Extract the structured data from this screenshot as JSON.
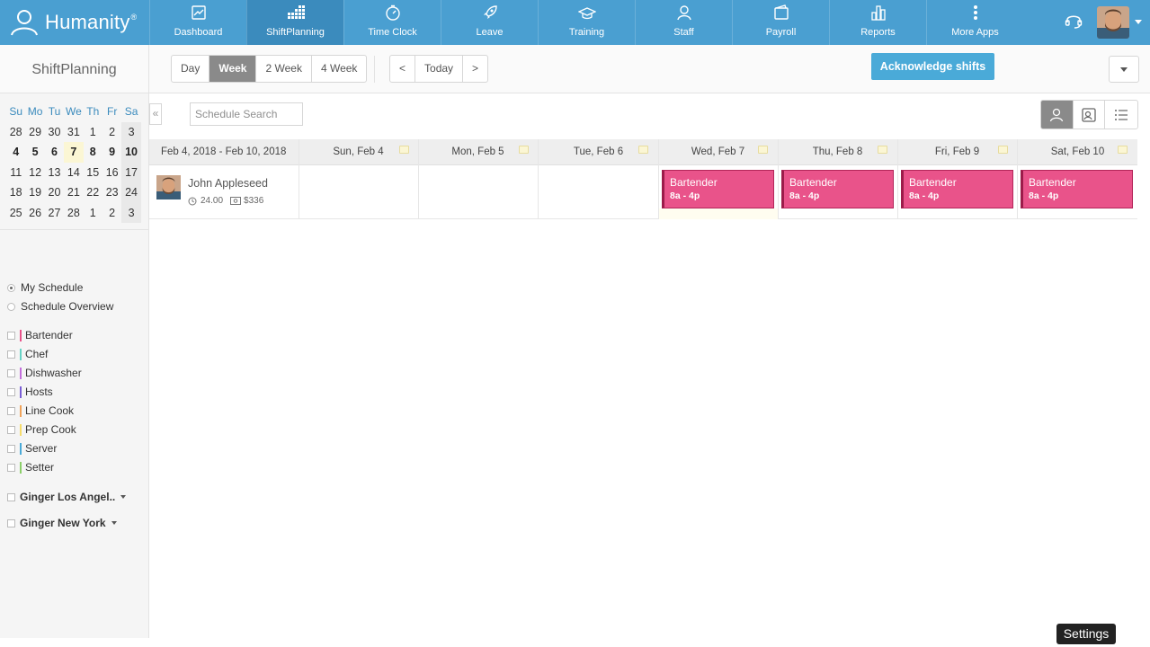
{
  "brand": {
    "name": "Humanity",
    "reg": "®"
  },
  "nav": [
    {
      "label": "Dashboard",
      "icon": "dashboard-icon",
      "active": false
    },
    {
      "label": "ShiftPlanning",
      "icon": "shiftplanning-icon",
      "active": true
    },
    {
      "label": "Time Clock",
      "icon": "clock-icon",
      "active": false
    },
    {
      "label": "Leave",
      "icon": "rocket-icon",
      "active": false
    },
    {
      "label": "Training",
      "icon": "graduation-cap-icon",
      "active": false
    },
    {
      "label": "Staff",
      "icon": "person-icon",
      "active": false
    },
    {
      "label": "Payroll",
      "icon": "wallet-icon",
      "active": false
    },
    {
      "label": "Reports",
      "icon": "bar-chart-icon",
      "active": false
    },
    {
      "label": "More Apps",
      "icon": "more-vertical-icon",
      "active": false
    }
  ],
  "sidebar": {
    "title": "ShiftPlanning",
    "calendar": {
      "weekdays": [
        "Su",
        "Mo",
        "Tu",
        "We",
        "Th",
        "Fr",
        "Sa"
      ],
      "weeks": [
        [
          "28",
          "29",
          "30",
          "31",
          "1",
          "2",
          "3"
        ],
        [
          "4",
          "5",
          "6",
          "7",
          "8",
          "9",
          "10"
        ],
        [
          "11",
          "12",
          "13",
          "14",
          "15",
          "16",
          "17"
        ],
        [
          "18",
          "19",
          "20",
          "21",
          "22",
          "23",
          "24"
        ],
        [
          "25",
          "26",
          "27",
          "28",
          "1",
          "2",
          "3"
        ]
      ],
      "current_week_index": 1,
      "today": "7"
    },
    "views": [
      {
        "label": "My Schedule",
        "selected": true
      },
      {
        "label": "Schedule Overview",
        "selected": false
      }
    ],
    "positions": [
      {
        "label": "Bartender",
        "color": "#e9538a"
      },
      {
        "label": "Chef",
        "color": "#67d3c6"
      },
      {
        "label": "Dishwasher",
        "color": "#c46fdc"
      },
      {
        "label": "Hosts",
        "color": "#7b5fd6"
      },
      {
        "label": "Line Cook",
        "color": "#f0a35a"
      },
      {
        "label": "Prep Cook",
        "color": "#f6dc6a"
      },
      {
        "label": "Server",
        "color": "#4aaad8"
      },
      {
        "label": "Setter",
        "color": "#8ccf6a"
      }
    ],
    "locations": [
      "Ginger Los Angel..",
      "Ginger New York"
    ]
  },
  "toolbar": {
    "range_buttons": [
      "Day",
      "Week",
      "2 Week",
      "4 Week"
    ],
    "active_range": "Week",
    "nav_buttons": [
      "<",
      "Today",
      ">"
    ],
    "acknowledge": "Acknowledge shifts"
  },
  "schedule": {
    "search_placeholder": "Schedule Search",
    "collapse_glyph": "«",
    "date_range": "Feb 4, 2018 - Feb 10, 2018",
    "days": [
      "Sun, Feb 4",
      "Mon, Feb 5",
      "Tue, Feb 6",
      "Wed, Feb 7",
      "Thu, Feb 8",
      "Fri, Feb 9",
      "Sat, Feb 10"
    ],
    "employee": {
      "name": "John Appleseed",
      "hours": "24.00",
      "pay": "$336"
    },
    "shifts": [
      {
        "day": "Wed, Feb 7",
        "title": "Bartender",
        "time": "8a - 4p"
      },
      {
        "day": "Thu, Feb 8",
        "title": "Bartender",
        "time": "8a - 4p"
      },
      {
        "day": "Fri, Feb 9",
        "title": "Bartender",
        "time": "8a - 4p"
      },
      {
        "day": "Sat, Feb 10",
        "title": "Bartender",
        "time": "8a - 4p"
      }
    ]
  },
  "tooltip": "Settings"
}
